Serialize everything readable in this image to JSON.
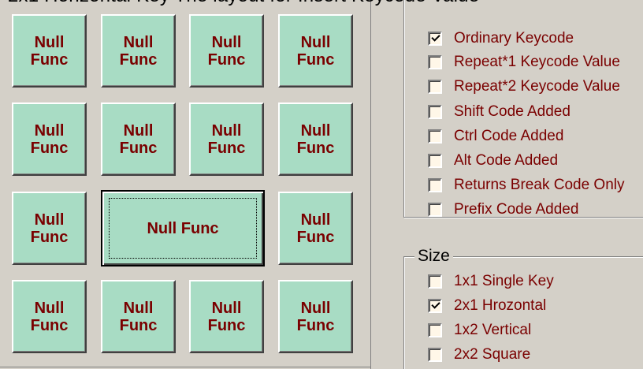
{
  "window": {
    "partial_title": "2x1 Horizontal Key The layout for Insert Keycode Value"
  },
  "keypad": {
    "keys": [
      {
        "label": "Null\nFunc",
        "size": "1x1"
      },
      {
        "label": "Null\nFunc",
        "size": "1x1"
      },
      {
        "label": "Null\nFunc",
        "size": "1x1"
      },
      {
        "label": "Null\nFunc",
        "size": "1x1"
      },
      {
        "label": "Null\nFunc",
        "size": "1x1"
      },
      {
        "label": "Null\nFunc",
        "size": "1x1"
      },
      {
        "label": "Null\nFunc",
        "size": "1x1"
      },
      {
        "label": "Null\nFunc",
        "size": "1x1"
      },
      {
        "label": "Null\nFunc",
        "size": "1x1"
      },
      {
        "label": "Null Func",
        "size": "2x1",
        "selected": true
      },
      {
        "label": "Null\nFunc",
        "size": "1x1"
      },
      {
        "label": "Null\nFunc",
        "size": "1x1"
      },
      {
        "label": "Null\nFunc",
        "size": "1x1"
      },
      {
        "label": "Null\nFunc",
        "size": "1x1"
      },
      {
        "label": "Null\nFunc",
        "size": "1x1"
      }
    ]
  },
  "keycode_options": [
    {
      "label": "Ordinary Keycode",
      "checked": true
    },
    {
      "label": "Repeat*1 Keycode Value",
      "checked": false
    },
    {
      "label": "Repeat*2 Keycode Value",
      "checked": false
    },
    {
      "label": "Shift Code Added",
      "checked": false
    },
    {
      "label": "Ctrl Code Added",
      "checked": false
    },
    {
      "label": "Alt Code Added",
      "checked": false
    },
    {
      "label": "Returns Break Code Only",
      "checked": false
    },
    {
      "label": "Prefix Code Added",
      "checked": false
    }
  ],
  "size_group": {
    "title": "Size",
    "options": [
      {
        "label": "1x1 Single Key",
        "checked": false
      },
      {
        "label": "2x1 Hrozontal",
        "checked": true
      },
      {
        "label": "1x2 Vertical",
        "checked": false
      },
      {
        "label": "2x2 Square",
        "checked": false
      }
    ]
  },
  "colors": {
    "key_face": "#a8dcc4",
    "key_text": "#7a0000",
    "option_text": "#7a0000",
    "window_bg": "#d4d0c8"
  },
  "icons": {
    "checked_box": "check-mark-icon",
    "unchecked_box": "empty-checkbox-icon"
  }
}
